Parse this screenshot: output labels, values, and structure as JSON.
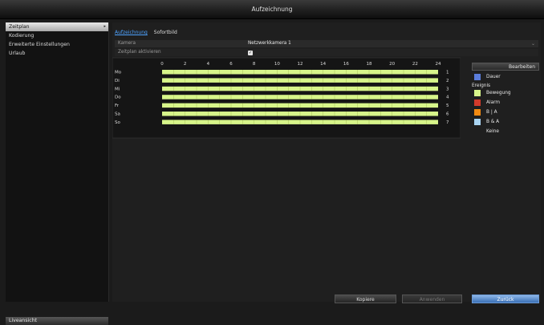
{
  "window": {
    "title": "Aufzeichnung"
  },
  "sidebar": {
    "items": [
      {
        "label": "Zeitplan"
      },
      {
        "label": "Kodierung"
      },
      {
        "label": "Erweiterte Einstellungen"
      },
      {
        "label": "Urlaub"
      }
    ],
    "active_index": 0,
    "liveview_label": "Liveansicht"
  },
  "tabs": [
    {
      "label": "Aufzeichnung"
    },
    {
      "label": "Sofortbild"
    }
  ],
  "form": {
    "camera_label": "Kamera",
    "camera_value": "Netzwerkkamera 1",
    "enable_label": "Zeitplan aktivieren",
    "enable_checked": true
  },
  "schedule": {
    "hour_ticks": [
      "0",
      "2",
      "4",
      "6",
      "8",
      "10",
      "12",
      "14",
      "16",
      "18",
      "20",
      "22",
      "24"
    ],
    "days": [
      {
        "label": "Mo",
        "index": "1"
      },
      {
        "label": "Di",
        "index": "2"
      },
      {
        "label": "Mi",
        "index": "3"
      },
      {
        "label": "Do",
        "index": "4"
      },
      {
        "label": "Fr",
        "index": "5"
      },
      {
        "label": "Sa",
        "index": "6"
      },
      {
        "label": "So",
        "index": "7"
      }
    ],
    "fill_color": "#d7f58a",
    "recorded_hours": [
      0,
      24
    ]
  },
  "legend": {
    "edit_label": "Bearbeiten",
    "dauer_label": "Dauer",
    "dauer_color": "#5b7ddb",
    "event_label": "Ereignis",
    "items": [
      {
        "label": "Bewegung",
        "color": "#d7f58a"
      },
      {
        "label": "Alarm",
        "color": "#d23a2b"
      },
      {
        "label": "B | A",
        "color": "#f28a12"
      },
      {
        "label": "B & A",
        "color": "#a9d4f2"
      }
    ],
    "none_label": "Keine"
  },
  "buttons": {
    "copy_label": "Kopiere",
    "apply_label": "Anwenden",
    "back_label": "Zurück"
  }
}
